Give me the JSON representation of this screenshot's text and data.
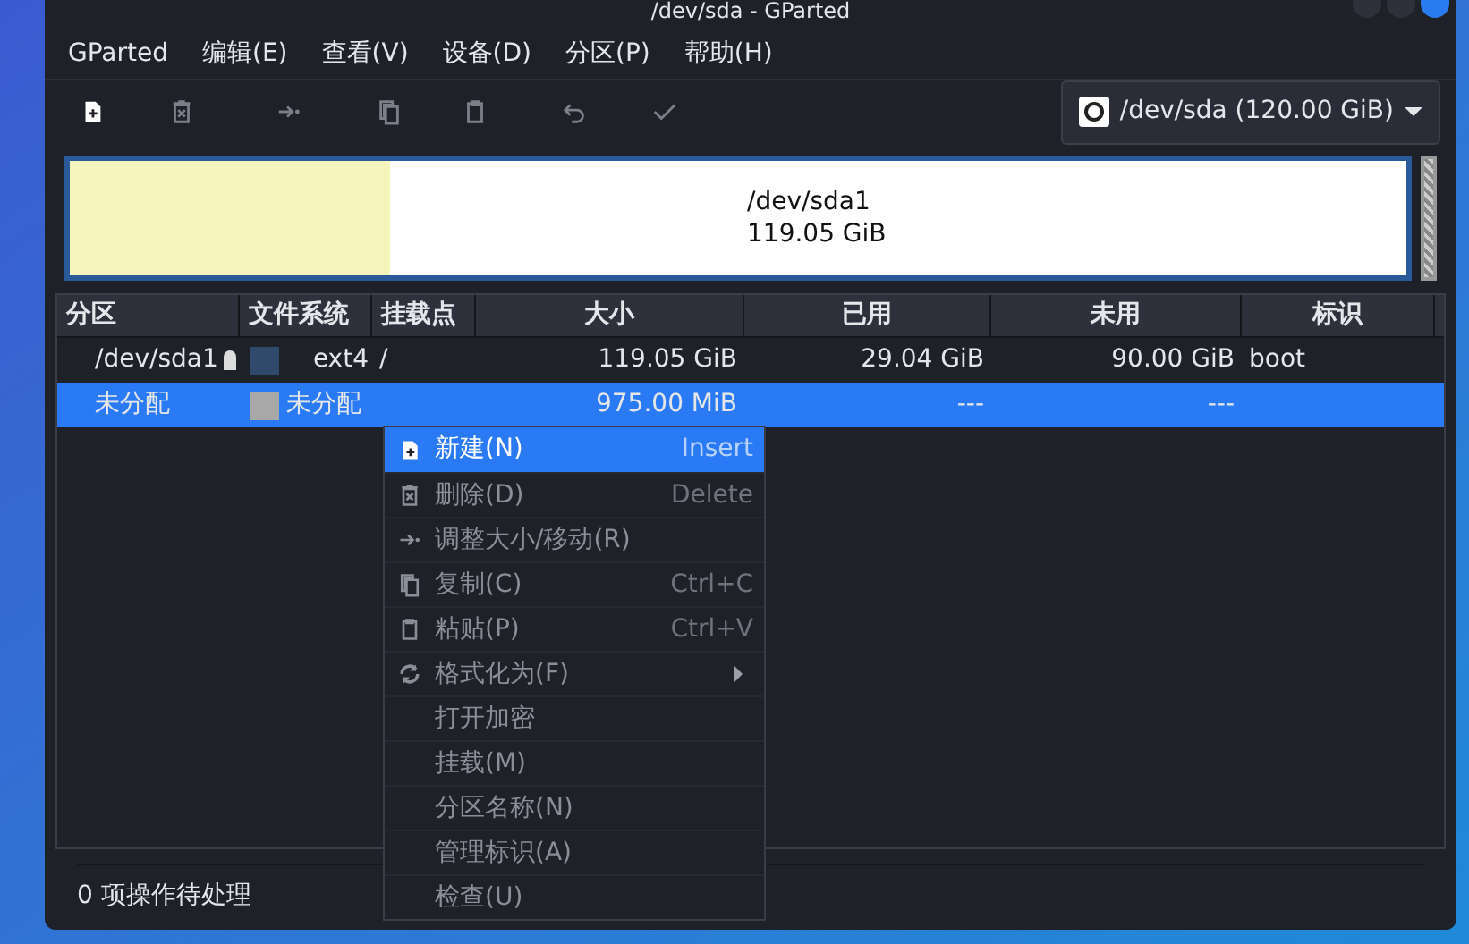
{
  "window": {
    "title": "/dev/sda - GParted"
  },
  "menubar": [
    "GParted",
    "编辑(E)",
    "查看(V)",
    "设备(D)",
    "分区(P)",
    "帮助(H)"
  ],
  "toolbar": [
    {
      "kind": "new",
      "disabled": false
    },
    {
      "kind": "delete",
      "disabled": true
    },
    {
      "kind": "resize",
      "disabled": true
    },
    {
      "kind": "copy",
      "disabled": true
    },
    {
      "kind": "paste",
      "disabled": true
    },
    {
      "kind": "undo",
      "disabled": true
    },
    {
      "kind": "apply",
      "disabled": true
    }
  ],
  "device": "/dev/sda (120.00 GiB)",
  "disk_map": {
    "name": "/dev/sda1",
    "size": "119.05 GiB",
    "level": 0.24
  },
  "table": {
    "columns": [
      "分区",
      "文件系统",
      "挂载点",
      "大小",
      "已用",
      "未用",
      "标识"
    ],
    "rows": [
      {
        "partition": "/dev/sda1",
        "locked": true,
        "color": "#2f4a6a",
        "filesystem": "ext4",
        "mount": "/",
        "size": "119.05 GiB",
        "used": "29.04 GiB",
        "unused": "90.00 GiB",
        "flags": "boot",
        "selected": false
      },
      {
        "partition": "未分配",
        "locked": false,
        "color": "#a8a8a8",
        "filesystem": "未分配",
        "mount": "",
        "size": "975.00 MiB",
        "used": "---",
        "unused": "---",
        "flags": "",
        "selected": true
      }
    ]
  },
  "context_menu": [
    {
      "kind": "new",
      "label": "新建(N)",
      "shortcut": "Insert",
      "disabled": false,
      "selected": true
    },
    {
      "kind": "delete",
      "label": "删除(D)",
      "shortcut": "Delete",
      "disabled": true,
      "selected": false
    },
    {
      "kind": "resize",
      "label": "调整大小/移动(R)",
      "disabled": true,
      "selected": false
    },
    {
      "kind": "copy",
      "label": "复制(C)",
      "shortcut": "Ctrl+C",
      "disabled": true,
      "selected": false
    },
    {
      "kind": "paste",
      "label": "粘贴(P)",
      "shortcut": "Ctrl+V",
      "disabled": true,
      "selected": false
    },
    {
      "kind": "format",
      "label": "格式化为(F)",
      "submenu": true,
      "disabled": true,
      "selected": false
    },
    {
      "label": "打开加密",
      "disabled": true,
      "selected": false
    },
    {
      "label": "挂载(M)",
      "disabled": true,
      "selected": false
    },
    {
      "label": "分区名称(N)",
      "disabled": true,
      "selected": false
    },
    {
      "label": "管理标识(A)",
      "disabled": true,
      "selected": false
    },
    {
      "label": "检查(U)",
      "disabled": true,
      "selected": false
    }
  ],
  "status_bar": "0 项操作待处理"
}
